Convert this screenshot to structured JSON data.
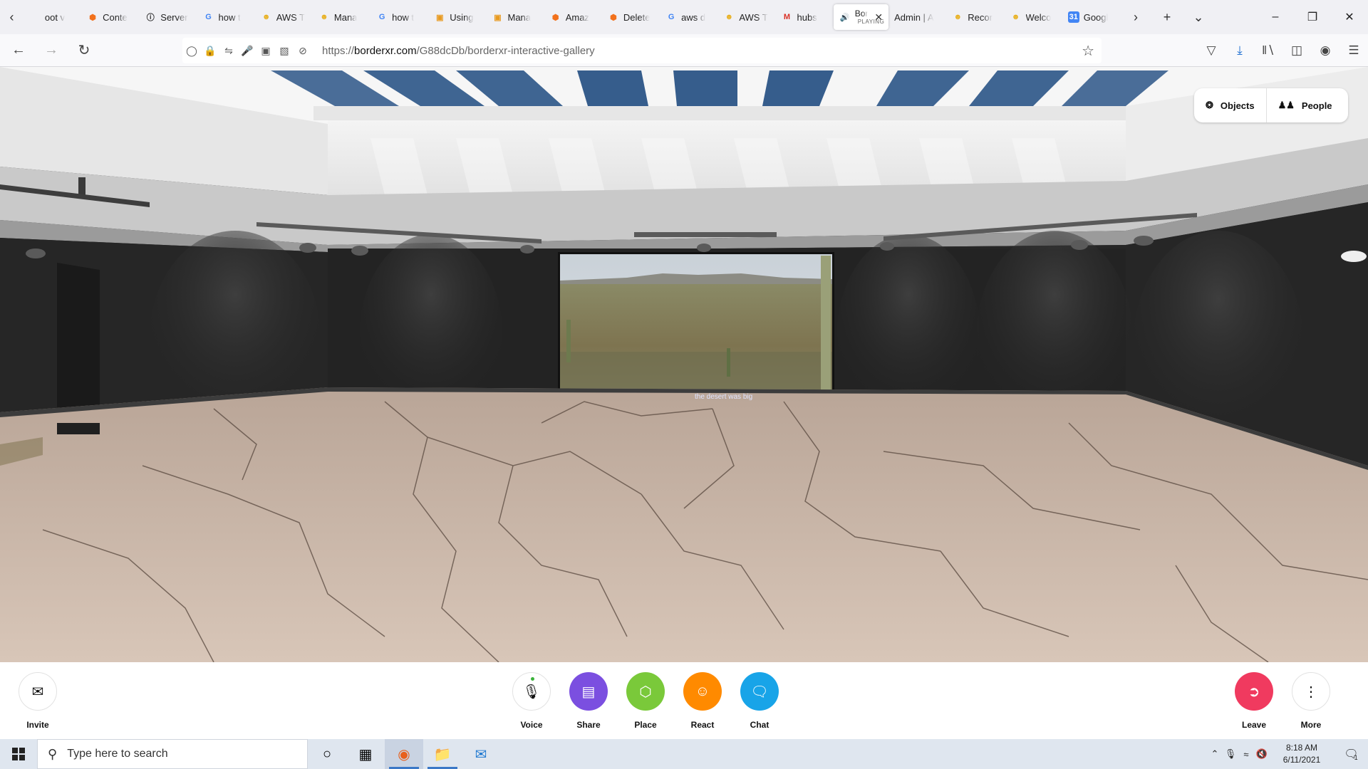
{
  "browser": {
    "tabs": [
      {
        "label": "oot v",
        "icon": "generic-icon"
      },
      {
        "label": "Conte",
        "icon": "aws-cube-icon"
      },
      {
        "label": "Server",
        "icon": "info-icon"
      },
      {
        "label": "how t",
        "icon": "google-icon"
      },
      {
        "label": "AWS T",
        "icon": "hubs-duck-icon"
      },
      {
        "label": "Mana",
        "icon": "hubs-duck-icon"
      },
      {
        "label": "how t",
        "icon": "google-icon"
      },
      {
        "label": "Using",
        "icon": "aws-docs-icon"
      },
      {
        "label": "Mana",
        "icon": "aws-docs-icon"
      },
      {
        "label": "Amaz",
        "icon": "aws-cube-icon"
      },
      {
        "label": "Delete",
        "icon": "aws-cube-icon"
      },
      {
        "label": "aws d",
        "icon": "google-icon"
      },
      {
        "label": "AWS T",
        "icon": "hubs-duck-icon"
      },
      {
        "label": "hubs",
        "icon": "gmail-icon"
      },
      {
        "label": "Bor",
        "sublabel": "PLAYING",
        "icon": "speaker-icon",
        "active": true
      },
      {
        "label": "Admin | A",
        "icon": "none"
      },
      {
        "label": "Recor",
        "icon": "hubs-duck-icon"
      },
      {
        "label": "Welco",
        "icon": "hubs-duck-icon"
      },
      {
        "label": "Googl",
        "icon": "google-calendar-icon"
      }
    ],
    "url": {
      "prefix": "https://",
      "host": "borderxr.com",
      "path": "/G88dcDb/borderxr-interactive-gallery"
    }
  },
  "scene": {
    "screen_caption": "the desert was big",
    "panel": {
      "objects_label": "Objects",
      "people_label": "People"
    }
  },
  "toolbar": {
    "invite": "Invite",
    "voice": "Voice",
    "share": "Share",
    "place": "Place",
    "react": "React",
    "chat": "Chat",
    "leave": "Leave",
    "more": "More",
    "colors": {
      "share": "#7b4fe0",
      "place": "#7ac93a",
      "react": "#ff8a00",
      "chat": "#18a4e8",
      "leave": "#f03a5f"
    }
  },
  "taskbar": {
    "search_placeholder": "Type here to search",
    "time": "8:18 AM",
    "date": "6/11/2021",
    "notification_count": "1"
  }
}
